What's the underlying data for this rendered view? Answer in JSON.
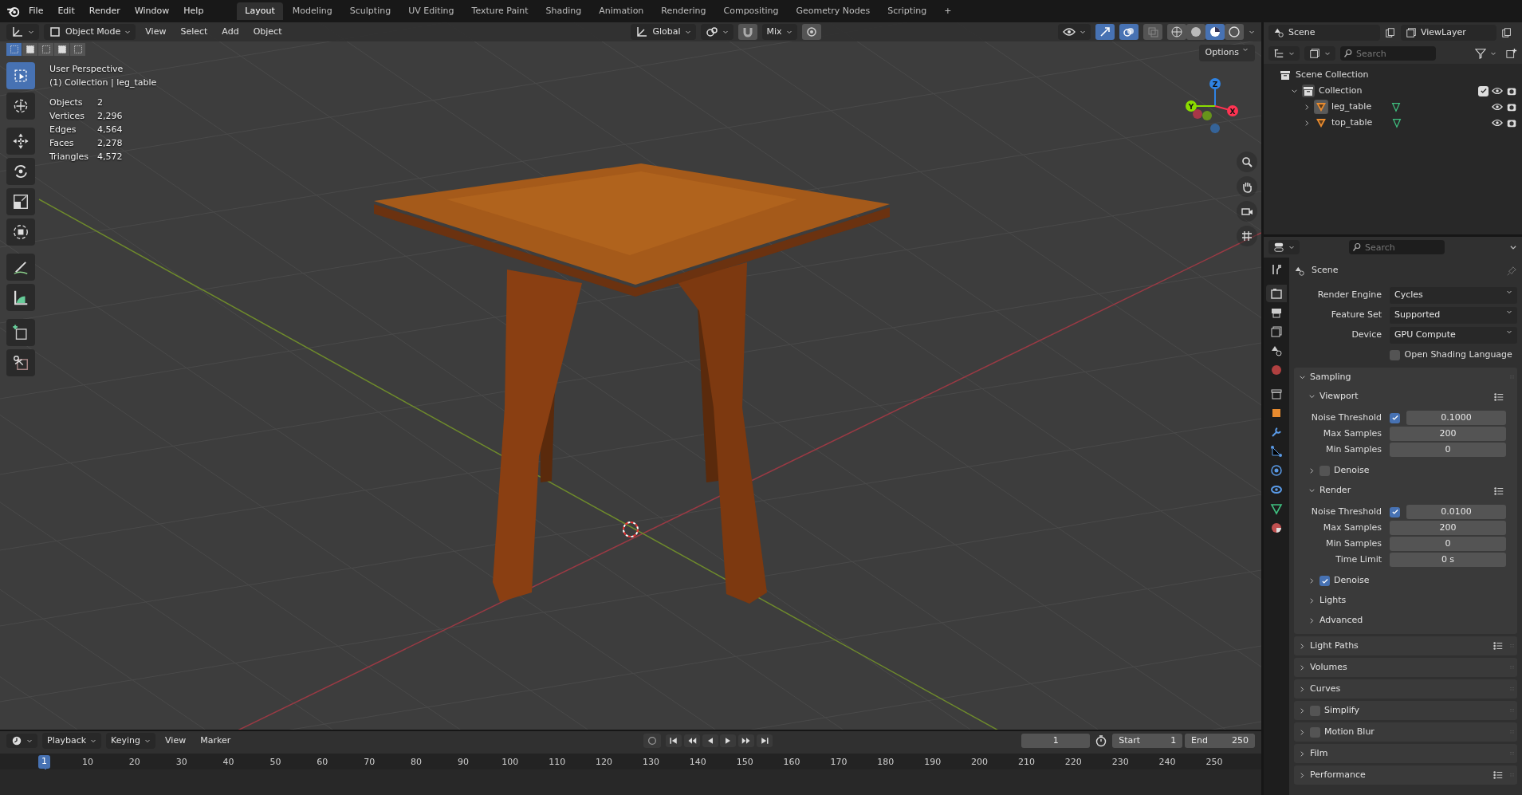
{
  "menu": [
    "File",
    "Edit",
    "Render",
    "Window",
    "Help"
  ],
  "workspaces": [
    {
      "label": "Layout",
      "selected": true
    },
    {
      "label": "Modeling",
      "selected": false
    },
    {
      "label": "Sculpting",
      "selected": false
    },
    {
      "label": "UV Editing",
      "selected": false
    },
    {
      "label": "Texture Paint",
      "selected": false
    },
    {
      "label": "Shading",
      "selected": false
    },
    {
      "label": "Animation",
      "selected": false
    },
    {
      "label": "Rendering",
      "selected": false
    },
    {
      "label": "Compositing",
      "selected": false
    },
    {
      "label": "Geometry Nodes",
      "selected": false
    },
    {
      "label": "Scripting",
      "selected": false
    }
  ],
  "add_workspace": "+",
  "scene": "Scene",
  "view_layer": "ViewLayer",
  "viewport": {
    "mode": "Object Mode",
    "menus": [
      "View",
      "Select",
      "Add",
      "Object"
    ],
    "orientation": "Global",
    "snap": "Mix",
    "options": "Options",
    "select_modes": [
      {
        "selected": true
      },
      {
        "selected": false
      },
      {
        "selected": false
      },
      {
        "selected": false
      },
      {
        "selected": false
      }
    ],
    "tools": [
      {
        "kind": "select",
        "selected": true
      },
      {
        "kind": "cursor",
        "selected": false
      },
      {
        "kind": "move",
        "selected": false
      },
      {
        "kind": "rotate",
        "selected": false
      },
      {
        "kind": "scale",
        "selected": false
      },
      {
        "kind": "transform",
        "selected": false
      },
      {
        "kind": "annotate",
        "selected": false
      },
      {
        "kind": "measure",
        "selected": false
      },
      {
        "kind": "add_cube",
        "selected": false
      },
      {
        "kind": "cut",
        "selected": false
      }
    ],
    "info": [
      "User Perspective",
      "(1) Collection | leg_table"
    ],
    "stats": [
      {
        "label": "Objects",
        "value": "2"
      },
      {
        "label": "Vertices",
        "value": "2,296"
      },
      {
        "label": "Edges",
        "value": "4,564"
      },
      {
        "label": "Faces",
        "value": "2,278"
      },
      {
        "label": "Triangles",
        "value": "4,572"
      }
    ],
    "gizmo": [
      {
        "label": "Z",
        "color": "#2f83e3"
      },
      {
        "label": "Y",
        "color": "#8bdc00"
      },
      {
        "label": "X",
        "color": "#ff3352"
      }
    ]
  },
  "outliner": {
    "search_placeholder": "Search",
    "tree": [
      {
        "label": "Scene Collection",
        "kind": "scene",
        "children": [
          {
            "label": "Collection",
            "kind": "collection",
            "expanded": true,
            "checked": true,
            "children": [
              {
                "label": "leg_table",
                "kind": "mesh",
                "expanded": false,
                "selected": true
              },
              {
                "label": "top_table",
                "kind": "mesh",
                "expanded": false,
                "selected": false
              }
            ]
          }
        ]
      }
    ]
  },
  "properties": {
    "search_placeholder": "Search",
    "context": "Scene",
    "tabs": [
      {
        "kind": "tool",
        "selected": false
      },
      {
        "kind": "render",
        "selected": true
      },
      {
        "kind": "output",
        "selected": false
      },
      {
        "kind": "view_layer",
        "selected": false
      },
      {
        "kind": "scene",
        "selected": false
      },
      {
        "kind": "world",
        "selected": false
      },
      {
        "kind": "collection",
        "selected": false
      },
      {
        "kind": "object",
        "selected": false
      },
      {
        "kind": "modifier",
        "selected": false
      },
      {
        "kind": "particles",
        "selected": false
      },
      {
        "kind": "physics",
        "selected": false
      },
      {
        "kind": "constraints",
        "selected": false
      },
      {
        "kind": "data",
        "selected": false
      },
      {
        "kind": "material",
        "selected": false
      }
    ],
    "fields": [
      {
        "label": "Render Engine",
        "value": "Cycles"
      },
      {
        "label": "Feature Set",
        "value": "Supported"
      },
      {
        "label": "Device",
        "value": "GPU Compute"
      }
    ],
    "osl": {
      "label": "Open Shading Language",
      "checked": false
    },
    "panels": [
      {
        "label": "Sampling",
        "expanded": true,
        "children": [
          {
            "label": "Viewport",
            "expanded": true,
            "presets": true,
            "rows": [
              {
                "kind": "check",
                "label": "Noise Threshold",
                "checked": true,
                "value": "0.1000"
              },
              {
                "kind": "number",
                "label": "Max Samples",
                "value": "200"
              },
              {
                "kind": "number",
                "label": "Min Samples",
                "value": "0"
              }
            ],
            "children": [
              {
                "label": "Denoise",
                "expanded": false,
                "checked": false
              }
            ]
          },
          {
            "label": "Render",
            "expanded": true,
            "presets": true,
            "rows": [
              {
                "kind": "check",
                "label": "Noise Threshold",
                "checked": true,
                "value": "0.0100"
              },
              {
                "kind": "number",
                "label": "Max Samples",
                "value": "200"
              },
              {
                "kind": "number",
                "label": "Min Samples",
                "value": "0"
              },
              {
                "kind": "number",
                "label": "Time Limit",
                "value": "0 s"
              }
            ],
            "children": [
              {
                "label": "Denoise",
                "expanded": false,
                "checked": true
              }
            ]
          },
          {
            "label": "Lights",
            "expanded": false
          },
          {
            "label": "Advanced",
            "expanded": false
          }
        ]
      },
      {
        "label": "Light Paths",
        "expanded": false,
        "presets": true
      },
      {
        "label": "Volumes",
        "expanded": false
      },
      {
        "label": "Curves",
        "expanded": false
      },
      {
        "label": "Simplify",
        "expanded": false,
        "checked": false
      },
      {
        "label": "Motion Blur",
        "expanded": false,
        "checked": false
      },
      {
        "label": "Film",
        "expanded": false
      },
      {
        "label": "Performance",
        "expanded": false,
        "presets": true
      }
    ]
  },
  "timeline": {
    "menus": [
      "Playback",
      "Keying",
      "View",
      "Marker"
    ],
    "current_frame": "1",
    "start_label": "Start",
    "start": "1",
    "end_label": "End",
    "end": "250",
    "playhead": "1",
    "ticks": [
      "10",
      "20",
      "30",
      "40",
      "50",
      "60",
      "70",
      "80",
      "90",
      "100",
      "110",
      "120",
      "130",
      "140",
      "150",
      "160",
      "170",
      "180",
      "190",
      "200",
      "210",
      "220",
      "230",
      "240",
      "250"
    ]
  }
}
